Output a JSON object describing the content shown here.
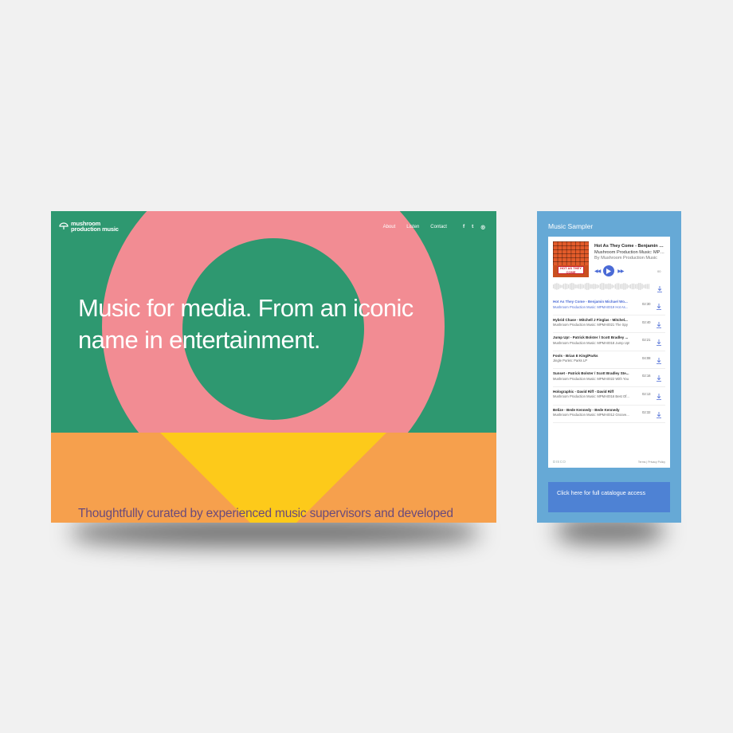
{
  "site": {
    "logo_line1": "mushroom",
    "logo_line2": "production music",
    "nav": [
      "About",
      "Listen",
      "Contact"
    ],
    "social_icons": [
      "facebook-icon",
      "twitter-icon",
      "instagram-icon"
    ],
    "social_glyphs": [
      "f",
      "t",
      "◎"
    ],
    "hero_line1": "Music for media. From an iconic",
    "hero_line2": "name in entertainment.",
    "subheading": "Thoughtfully curated by experienced music supervisors and developed",
    "colors": {
      "green": "#2e9870",
      "pink": "#f28c93",
      "orange": "#f6a04d",
      "yellow": "#fdca1a",
      "sub_text": "#6b4a7a"
    }
  },
  "sampler": {
    "title": "Music Sampler",
    "now_playing": {
      "title": "Hot As They Come - Benjamin Michael Wo...",
      "album": "Mushroom Production Music: MPMA0019 Hot A...",
      "by": "By Mushroom Production Music",
      "cover_text": "HOT AS THEY COME",
      "elapsed": "00"
    },
    "tracks": [
      {
        "title": "Hot As They Come - Benjamin Michael Wo...",
        "subtitle": "Mushroom Production Music: MPMA0019 Hot As...",
        "duration": "02:30",
        "active": true
      },
      {
        "title": "Hybrid Chase - Mitchell J Finglas - Mitchel...",
        "subtitle": "Mushroom Production Music: MPMA0021 The Spy",
        "duration": "02:40",
        "active": false
      },
      {
        "title": "Jump Up! - Patrick Bolster / Scott Bradley ...",
        "subtitle": "Mushroom Production Music: MPMA0018 Jump Up!",
        "duration": "02:21",
        "active": false
      },
      {
        "title": "Fools - Brian E King/Parks",
        "subtitle": "Jingle Punks: Parks LP",
        "duration": "04:08",
        "active": false
      },
      {
        "title": "Sunset - Patrick Bolster / Scott Bradley Ste...",
        "subtitle": "Mushroom Production Music: MPMA0022 With You",
        "duration": "02:16",
        "active": false
      },
      {
        "title": "Holographic - David Riff - David Riff",
        "subtitle": "Mushroom Production Music: MPMA0016 Best Of...",
        "duration": "02:13",
        "active": false
      },
      {
        "title": "Belize - Bede Kennedy - Bede Kennedy",
        "subtitle": "Mushroom Production Music: MPMA0012 Groove...",
        "duration": "02:32",
        "active": false
      }
    ],
    "brand": "DISCO",
    "terms": "Terms | Privacy Policy",
    "cta_label": "Click here for full catalogue access",
    "colors": {
      "panel": "#66a9d6",
      "accent": "#4b6bd6",
      "cta": "#4e82d4"
    }
  }
}
